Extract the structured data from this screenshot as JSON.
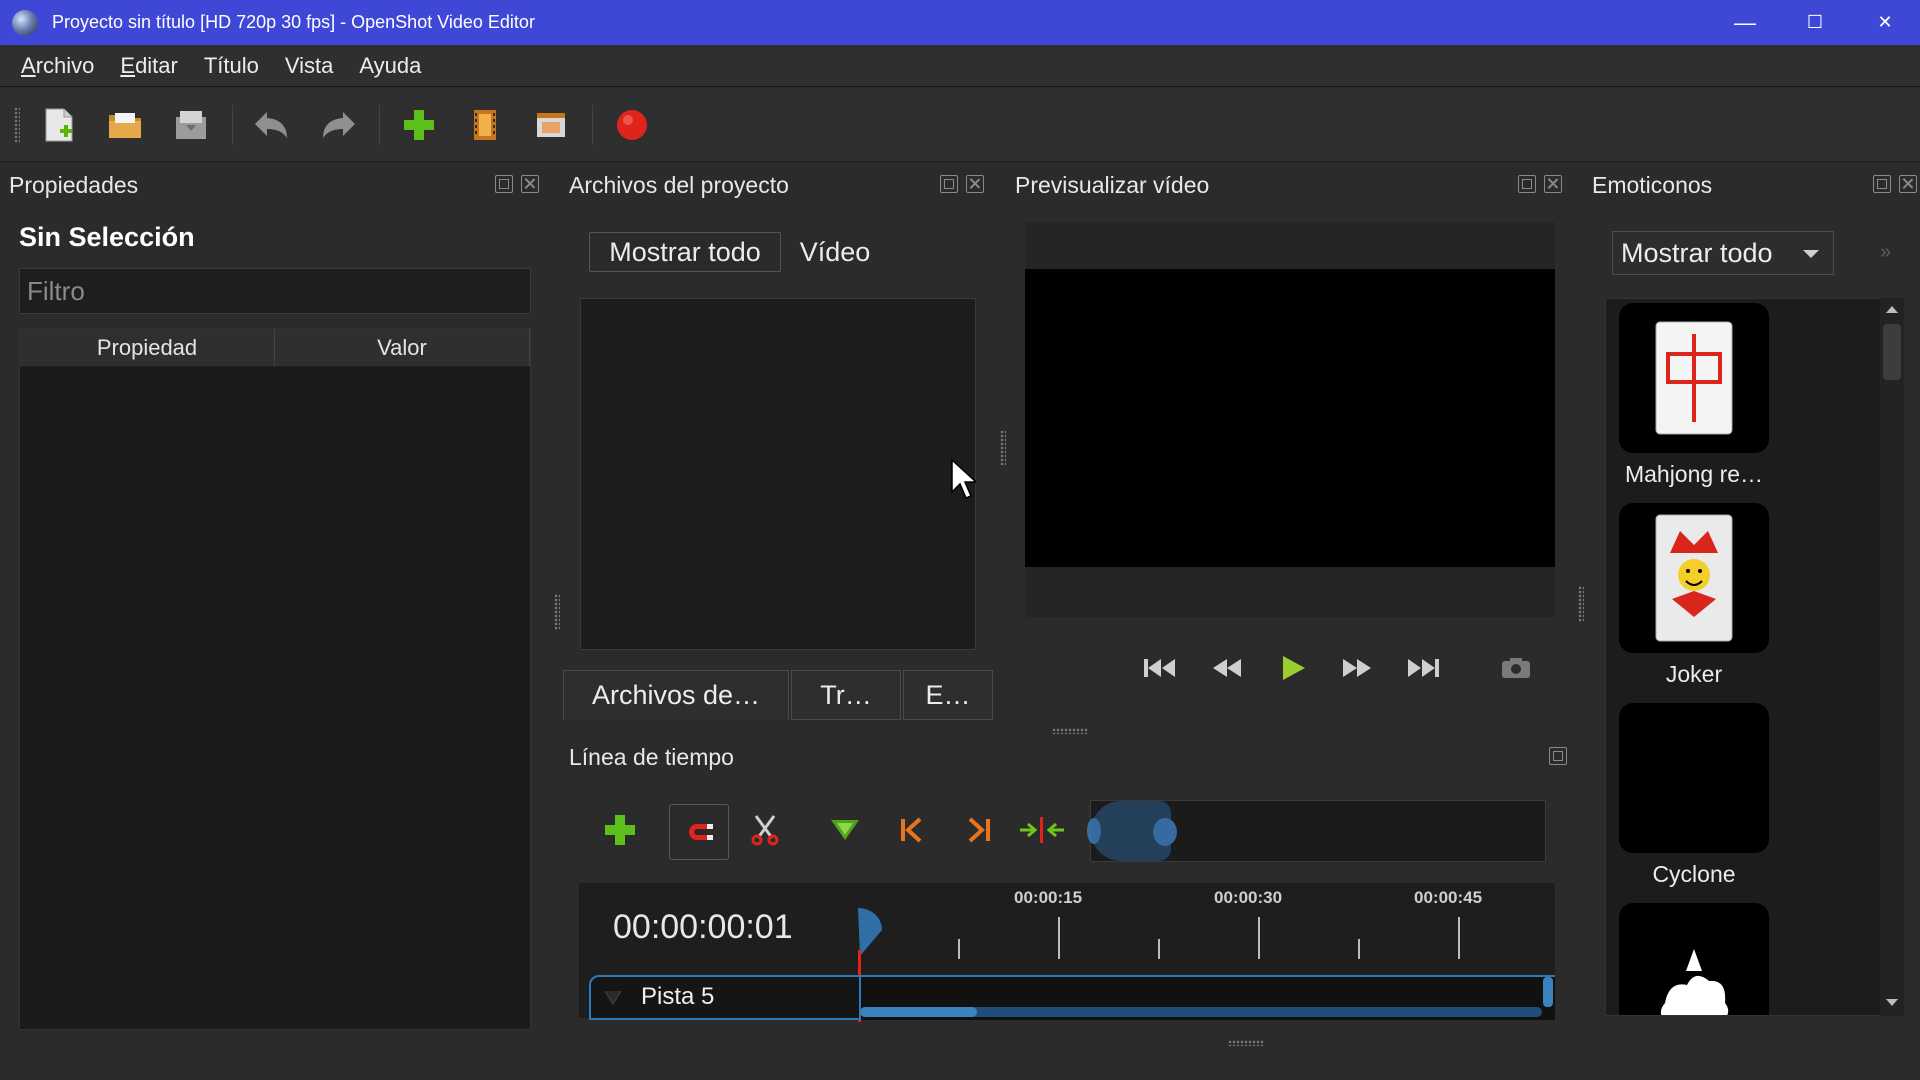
{
  "window": {
    "title": "Proyecto sin título [HD 720p 30 fps] - OpenShot Video Editor",
    "minimize": "—",
    "maximize": "☐",
    "close": "✕"
  },
  "menu": [
    {
      "label": "rchivo",
      "mnemonic": "A"
    },
    {
      "label": "ditar",
      "mnemonic": "E"
    },
    {
      "label": "Título",
      "mnemonic": ""
    },
    {
      "label": "Vista",
      "mnemonic": ""
    },
    {
      "label": "Ayuda",
      "mnemonic": ""
    }
  ],
  "toolbar": {
    "icons": [
      "new-project-icon",
      "open-project-icon",
      "save-project-icon",
      "undo-icon",
      "redo-icon",
      "import-files-icon",
      "choose-profile-icon",
      "fullscreen-icon",
      "export-video-icon"
    ]
  },
  "properties": {
    "title": "Propiedades",
    "heading": "Sin Selección",
    "filter_placeholder": "Filtro",
    "col_property": "Propiedad",
    "col_value": "Valor"
  },
  "project_files": {
    "title": "Archivos del proyecto",
    "show_all": "Mostrar todo",
    "video": "Vídeo",
    "tabs": [
      "Archivos de…",
      "Tr…",
      "E…"
    ]
  },
  "preview": {
    "title": "Previsualizar vídeo"
  },
  "timeline": {
    "title": "Línea de tiempo",
    "timecode": "00:00:00:01",
    "ruler_labels": [
      "00:00:15",
      "00:00:30",
      "00:00:45"
    ],
    "track_name": "Pista 5"
  },
  "emoji": {
    "title": "Emoticonos",
    "filter_value": "Mostrar todo",
    "items": [
      "Mahjong re…",
      "Joker",
      "Cyclone",
      ""
    ]
  },
  "colors": {
    "titlebar": "#3f48d6",
    "accent": "#2e79b8",
    "record": "#e0241b",
    "play_green": "#9acd32"
  }
}
